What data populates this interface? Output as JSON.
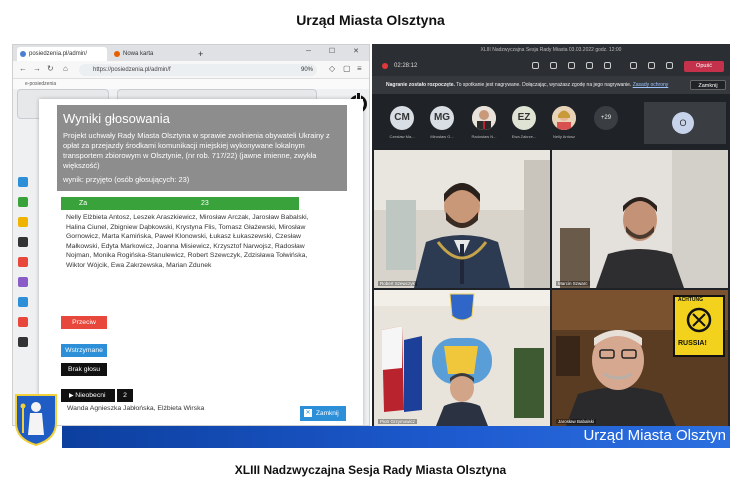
{
  "page": {
    "top_title": "Urząd Miasta Olsztyna",
    "bottom_title": "XLIII Nadzwyczajna Sesja Rady Miasta Olsztyna"
  },
  "browser": {
    "tabs": [
      {
        "label": "posiedzenia.pl/admin/",
        "icon": "globe-icon"
      },
      {
        "label": "Nowa karta",
        "icon": "firefox-icon"
      }
    ],
    "new_tab": "+",
    "url": "https://posiedzenia.pl/admin/f",
    "zoom": "90%",
    "bookmark": "e-posiedzenia"
  },
  "modal": {
    "title": "Wyniki głosowania",
    "description": "Projekt uchwały Rady Miasta Olsztyna w sprawie zwolnienia obywateli Ukrainy z opłat za przejazdy środkami komunikacji miejskiej wykonywane lokalnym transportem zbiorowym w Olsztynie, (nr rob. 717/22) (jawne imienne, zwykła większość)",
    "result": "wynik: przyjęto (osób głosujących: 23)",
    "za_label": "Za",
    "za_count": "23",
    "za_names": "Nelly Elżbieta Antosz, Leszek Araszkiewicz, Mirosław Arczak, Jarosław Babalski, Halina Ciunel, Zbigniew Dąbkowski, Krystyna Flis, Tomasz Głażewski, Mirosław Gornowicz, Marta Kamińska, Paweł Klonowski, Łukasz Łukaszewski, Czesław Małkowski, Edyta Markowicz, Joanna Misiewicz, Krzysztof Narwojsz, Radosław Nojman, Monika Rogińska-Stanulewicz, Robert Szewczyk, Zdzisława Tołwińska, Wiktor Wójcik, Ewa Zakrzewska, Marian Zdunek",
    "przeciw_label": "Przeciw",
    "wstrzymane_label": "Wstrzymane",
    "brak_label": "Brak głosu",
    "nieobecni_label": "Nieobecni",
    "nieobecni_count": "2",
    "nieobecni_names": "Wanda Agnieszka Jabłońska, Elżbieta Wirska",
    "close_label": "Zamknij"
  },
  "meeting": {
    "title": "XLIII Nadzwyczajna Sesja Rady Miasta 03.03.2022 godz. 12:00",
    "timer": "02:28:12",
    "leave_label": "Opuść",
    "notice_bold": "Nagranie zostało rozpoczęte.",
    "notice_text": " To spotkanie jest nagrywane. Dołączając, wyrażasz zgodę na jego nagrywanie.",
    "notice_link": "Zasady ochrony",
    "notice_close": "Zamknij",
    "participants": [
      {
        "initials": "CM",
        "name": "Czesław Ma...",
        "color": "#d9dde4"
      },
      {
        "initials": "MG",
        "name": "Mirosław G...",
        "color": "#d9dde4"
      },
      {
        "initials": "",
        "name": "Radosław N...",
        "color": "#e8e2da"
      },
      {
        "initials": "EZ",
        "name": "Ewa Zakrze...",
        "color": "#dfe3d4"
      },
      {
        "initials": "",
        "name": "Nelly Antosz",
        "color": "#d8b8a0"
      }
    ],
    "more_count": "+29",
    "o_avatar": "O",
    "video_names": [
      "Robert Szewczyk",
      "Marcin Szwarc",
      "Piotr Grzymowicz",
      "Jarosław Babalski"
    ]
  },
  "sign": {
    "achtung": "ACHTUNG",
    "russia": "RUSSIA!"
  },
  "banner": {
    "text": "Urząd Miasta Olsztyn"
  },
  "colors": {
    "banner_blue": "#1e5bd0",
    "za_green": "#3aa23a",
    "przeciw_red": "#e8473b",
    "wstrzymane_blue": "#2d8fd8",
    "modal_header_gray": "#8d8d8d"
  }
}
